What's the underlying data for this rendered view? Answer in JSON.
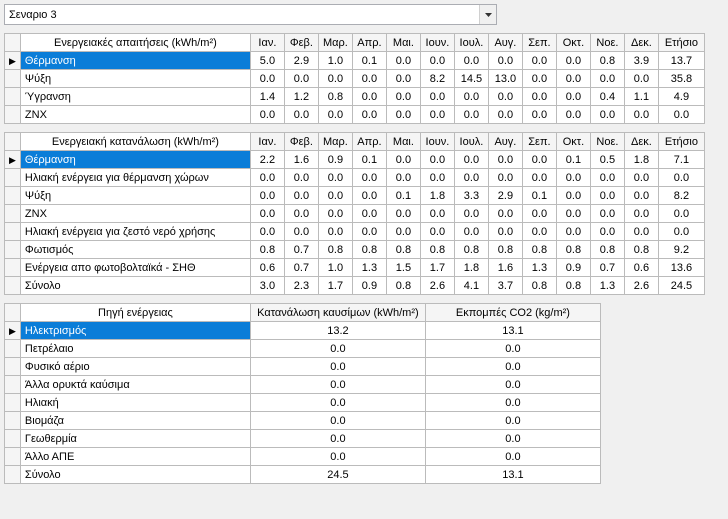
{
  "dropdown": {
    "selected": "Σεναριο 3"
  },
  "months": [
    "Ιαν.",
    "Φεβ.",
    "Μαρ.",
    "Απρ.",
    "Μαι.",
    "Ιουν.",
    "Ιουλ.",
    "Αυγ.",
    "Σεπ.",
    "Οκτ.",
    "Νοε.",
    "Δεκ."
  ],
  "annual_label": "Ετήσιο",
  "table1": {
    "title": "Ενεργειακές απαιτήσεις (kWh/m²)",
    "rows": [
      {
        "label": "Θέρμανση",
        "selected": true,
        "vals": [
          "5.0",
          "2.9",
          "1.0",
          "0.1",
          "0.0",
          "0.0",
          "0.0",
          "0.0",
          "0.0",
          "0.0",
          "0.8",
          "3.9",
          "13.7"
        ]
      },
      {
        "label": "Ψύξη",
        "selected": false,
        "vals": [
          "0.0",
          "0.0",
          "0.0",
          "0.0",
          "0.0",
          "8.2",
          "14.5",
          "13.0",
          "0.0",
          "0.0",
          "0.0",
          "0.0",
          "35.8"
        ]
      },
      {
        "label": "Ύγρανση",
        "selected": false,
        "vals": [
          "1.4",
          "1.2",
          "0.8",
          "0.0",
          "0.0",
          "0.0",
          "0.0",
          "0.0",
          "0.0",
          "0.0",
          "0.4",
          "1.1",
          "4.9"
        ]
      },
      {
        "label": "ΖΝΧ",
        "selected": false,
        "vals": [
          "0.0",
          "0.0",
          "0.0",
          "0.0",
          "0.0",
          "0.0",
          "0.0",
          "0.0",
          "0.0",
          "0.0",
          "0.0",
          "0.0",
          "0.0"
        ]
      }
    ]
  },
  "table2": {
    "title": "Ενεργειακή κατανάλωση (kWh/m²)",
    "rows": [
      {
        "label": "Θέρμανση",
        "selected": true,
        "vals": [
          "2.2",
          "1.6",
          "0.9",
          "0.1",
          "0.0",
          "0.0",
          "0.0",
          "0.0",
          "0.0",
          "0.1",
          "0.5",
          "1.8",
          "7.1"
        ]
      },
      {
        "label": "Ηλιακή ενέργεια για θέρμανση χώρων",
        "selected": false,
        "vals": [
          "0.0",
          "0.0",
          "0.0",
          "0.0",
          "0.0",
          "0.0",
          "0.0",
          "0.0",
          "0.0",
          "0.0",
          "0.0",
          "0.0",
          "0.0"
        ]
      },
      {
        "label": "Ψύξη",
        "selected": false,
        "vals": [
          "0.0",
          "0.0",
          "0.0",
          "0.0",
          "0.1",
          "1.8",
          "3.3",
          "2.9",
          "0.1",
          "0.0",
          "0.0",
          "0.0",
          "8.2"
        ]
      },
      {
        "label": "ΖΝΧ",
        "selected": false,
        "vals": [
          "0.0",
          "0.0",
          "0.0",
          "0.0",
          "0.0",
          "0.0",
          "0.0",
          "0.0",
          "0.0",
          "0.0",
          "0.0",
          "0.0",
          "0.0"
        ]
      },
      {
        "label": "Ηλιακή ενέργεια για ζεστό νερό χρήσης",
        "selected": false,
        "vals": [
          "0.0",
          "0.0",
          "0.0",
          "0.0",
          "0.0",
          "0.0",
          "0.0",
          "0.0",
          "0.0",
          "0.0",
          "0.0",
          "0.0",
          "0.0"
        ]
      },
      {
        "label": "Φωτισμός",
        "selected": false,
        "vals": [
          "0.8",
          "0.7",
          "0.8",
          "0.8",
          "0.8",
          "0.8",
          "0.8",
          "0.8",
          "0.8",
          "0.8",
          "0.8",
          "0.8",
          "9.2"
        ]
      },
      {
        "label": "Ενέργεια απο φωτοβολταϊκά - ΣΗΘ",
        "selected": false,
        "vals": [
          "0.6",
          "0.7",
          "1.0",
          "1.3",
          "1.5",
          "1.7",
          "1.8",
          "1.6",
          "1.3",
          "0.9",
          "0.7",
          "0.6",
          "13.6"
        ]
      },
      {
        "label": "Σύνολο",
        "selected": false,
        "vals": [
          "3.0",
          "2.3",
          "1.7",
          "0.9",
          "0.8",
          "2.6",
          "4.1",
          "3.7",
          "0.8",
          "0.8",
          "1.3",
          "2.6",
          "24.5"
        ]
      }
    ]
  },
  "table3": {
    "title": "Πηγή ενέργειας",
    "col1": "Κατανάλωση καυσίμων (kWh/m²)",
    "col2": "Εκπομπές CO2 (kg/m²)",
    "rows": [
      {
        "label": "Ηλεκτρισμός",
        "selected": true,
        "v1": "13.2",
        "v2": "13.1"
      },
      {
        "label": "Πετρέλαιο",
        "selected": false,
        "v1": "0.0",
        "v2": "0.0"
      },
      {
        "label": "Φυσικό αέριο",
        "selected": false,
        "v1": "0.0",
        "v2": "0.0"
      },
      {
        "label": "Άλλα ορυκτά καύσιμα",
        "selected": false,
        "v1": "0.0",
        "v2": "0.0"
      },
      {
        "label": "Ηλιακή",
        "selected": false,
        "v1": "0.0",
        "v2": "0.0"
      },
      {
        "label": "Βιομάζα",
        "selected": false,
        "v1": "0.0",
        "v2": "0.0"
      },
      {
        "label": "Γεωθερμία",
        "selected": false,
        "v1": "0.0",
        "v2": "0.0"
      },
      {
        "label": "Άλλο ΑΠΕ",
        "selected": false,
        "v1": "0.0",
        "v2": "0.0"
      },
      {
        "label": "Σύνολο",
        "selected": false,
        "v1": "24.5",
        "v2": "13.1"
      }
    ]
  }
}
